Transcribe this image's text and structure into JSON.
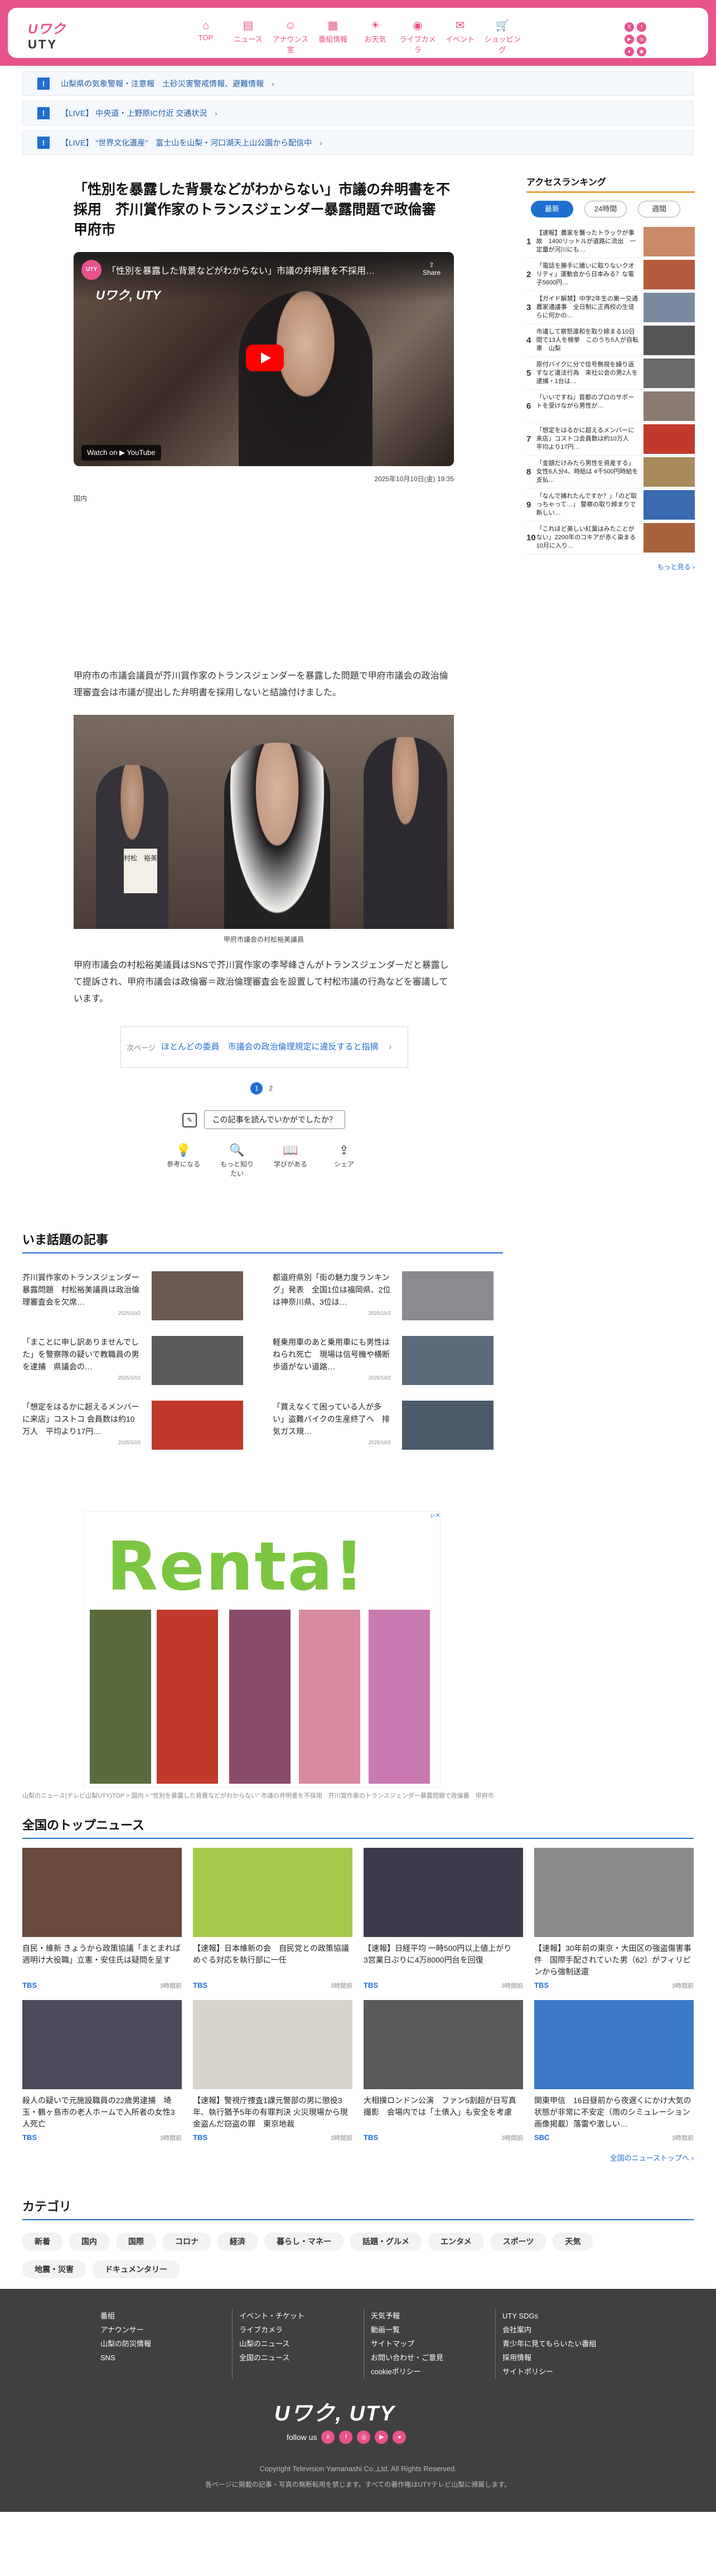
{
  "header": {
    "logo_top": "Uワク",
    "logo_bottom": "UTY",
    "nav": [
      {
        "label": "TOP",
        "icon": "⌂"
      },
      {
        "label": "ニュース",
        "icon": "▤"
      },
      {
        "label": "アナウンス室",
        "icon": "☺"
      },
      {
        "label": "番組情報",
        "icon": "▦"
      },
      {
        "label": "お天気",
        "icon": "☀"
      },
      {
        "label": "ライブカメラ",
        "icon": "◉"
      },
      {
        "label": "イベント",
        "icon": "✉"
      },
      {
        "label": "ショッピング",
        "icon": "🛒"
      }
    ],
    "social": [
      "X",
      "f",
      "▶",
      "◎",
      "●",
      "◉"
    ]
  },
  "alerts": [
    {
      "text": "山梨県の気象警報・注意報　土砂災害警戒情報、避難情報"
    },
    {
      "text": "【LIVE】 中央道・上野原IC付近 交通状況"
    },
    {
      "text": "【LIVE】 \"世界文化遺産\"　富士山を山梨・河口湖天上山公園から配信中"
    }
  ],
  "article": {
    "title": "「性別を暴露した背景などがわからない」市議の弁明書を不採用　芥川賞作家のトランスジェンダー暴露問題で政倫審　甲府市",
    "video_title": "「性別を暴露した背景などがわからない」市議の弁明書を不採用…",
    "video_logo": "Uワク, UTY",
    "share": "Share",
    "watch_on": "Watch on ▶ YouTube",
    "date": "2025年10月10日(金) 19:35",
    "category": "国内",
    "body1": "甲府市の市議会議員が芥川賞作家のトランスジェンダーを暴露した問題で甲府市議会の政治倫理審査会は市議が提出した弁明書を採用しないと結論付けました。",
    "photo_caption": "甲府市議会の村松裕美議員",
    "photo_nameplate": "村松　裕美",
    "body2": "甲府市議会の村松裕美議員はSNSで芥川賞作家の李琴峰さんがトランスジェンダーだと暴露して提訴され、甲府市議会は政倫審＝政治倫理審査会を設置して村松市議の行為などを審議しています。",
    "next_label": "次ページ",
    "next_title": "ほとんどの委員　市議会の政治倫理規定に違反すると指摘",
    "pages": [
      "1",
      "2"
    ],
    "feedback": "この記事を読んでいかがでしたか？",
    "reactions": [
      {
        "label": "参考になる",
        "icon": "💡"
      },
      {
        "label": "もっと知りたい",
        "icon": "🔍"
      },
      {
        "label": "学びがある",
        "icon": "📖"
      },
      {
        "label": "シェア",
        "icon": "⇪"
      }
    ]
  },
  "ranking": {
    "title": "アクセスランキング",
    "tabs": [
      "最新",
      "24時間",
      "週間"
    ],
    "items": [
      {
        "n": "1",
        "text": "【速報】農家を襲ったトラックが事故　1400リットルが道路に流出　一定量が河川にも…",
        "color": "#c98a6a"
      },
      {
        "n": "2",
        "text": "「電話を勝手に嬉いに取りないクオリティ」運動会から日本みる？な電子5600円…",
        "color": "#b55a3a"
      },
      {
        "n": "3",
        "text": "【ガイド解禁】中学2年生の第一交通農家通議事　全日制に正再校の生徒らに何かの…",
        "color": "#7a8aa0"
      },
      {
        "n": "4",
        "text": "市議して察怒違和を取り締まる10日間で13人を検挙　このうち5人が自転車　山梨",
        "color": "#555"
      },
      {
        "n": "5",
        "text": "原付バイクに分で信号無視を繰り返すなど違法行為　来社公会の男2人を逮捕・1台は…",
        "color": "#6a6a6a"
      },
      {
        "n": "6",
        "text": "「いいですね」首都のプロのサポートを受けながら男性が…",
        "color": "#8a7a70"
      },
      {
        "n": "7",
        "text": "「想定をはるかに超えるメンバーに来店」コストコ会員数は約10万人　平均より17円…",
        "color": "#c0392b"
      },
      {
        "n": "8",
        "text": "「金額だけみたら男性を資産する」女性6人分4、時給は 4千500円時給を支払…",
        "color": "#a88a5a"
      },
      {
        "n": "9",
        "text": "「なんで捕れたんですか？」「のど取っちゃって…」 警察の取り締まりで新しい…",
        "color": "#3a6ab0"
      },
      {
        "n": "10",
        "text": "「これほど美しい紅葉はみたことがない」2200年のコキアが赤く染まる　10月に入り…",
        "color": "#a8623a"
      }
    ],
    "more": "もっと見る ›"
  },
  "wadai": {
    "title": "いま話題の記事",
    "items": [
      {
        "text": "芥川賞作家のトランスジェンダー暴露問題　村松裕美議員は政治倫理審査会を欠席…",
        "date": "2025/10/2",
        "color": "#6a5a50"
      },
      {
        "text": "都道府県別「街の魅力度ランキング」発表　全国1位は福岡県、2位は神奈川県、3位は…",
        "date": "2025/10/2",
        "color": "#8a8a90"
      },
      {
        "text": "「まことに申し訳ありませんでした」を警察隊の疑いで教職員の男を逮捕　県議会の…",
        "date": "2025/10/2",
        "color": "#5a5a5a"
      },
      {
        "text": "軽乗用車のあと乗用車にも男性はねられ死亡　現場は信号機や横断歩道がない道路…",
        "date": "2025/10/2",
        "color": "#5a6a7a"
      },
      {
        "text": "「想定をはるかに超えるメンバーに来店」コストコ 会員数は約10万人　平均より17円…",
        "date": "2025/10/2",
        "color": "#c0392b"
      },
      {
        "text": "「買えなくて困っている人が多い」盗難バイクの生産終了へ　排気ガス規…",
        "date": "2025/10/2",
        "color": "#4a5a6a"
      }
    ]
  },
  "ad": {
    "brand": "Renta!",
    "marker": "▷✕"
  },
  "breadcrumb": "山梨のニュース(テレビ山梨UTY)TOP > 国内 > \"性別を暴露した背景などがわからない\" 市議の弁明書を不採用　芥川賞作家のトランスジェンダー暴露問題で政倫審　甲府市",
  "topnews": {
    "title": "全国のトップニュース",
    "items": [
      {
        "text": "自民・維新 きょうから政策協議「まとまれば週明け大役職」立憲・安住氏は疑問を呈す",
        "src": "TBS",
        "time": "3時間前",
        "color": "#6a4a3a"
      },
      {
        "text": "【速報】日本維新の会　自民党との政策協議めぐる対応を執行部に一任",
        "src": "TBS",
        "time": "3時間前",
        "color": "#a7c94a"
      },
      {
        "text": "【速報】日経平均 一時500円以上値上がり　3営業日ぶりに4万8000円台を回復",
        "src": "TBS",
        "time": "3時間前",
        "color": "#3a3a4a"
      },
      {
        "text": "【速報】30年前の東京・大田区の強盗傷害事件　国際手配されていた男（62）がフィリピンから強制送還",
        "src": "TBS",
        "time": "3時間前",
        "color": "#8a8a8a"
      },
      {
        "text": "殺人の疑いで元施設職員の22歳男逮捕　埼玉・鶴ヶ島市の老人ホームで入所者の女性3人死亡",
        "src": "TBS",
        "time": "3時間前",
        "color": "#4a4a5a"
      },
      {
        "text": "【速報】警視庁捜査1課元警部の男に懲役3年、執行猶予5年の有罪判決 火災現場から現金盗んだ窃盗の罪　東京地裁",
        "src": "TBS",
        "time": "3時間前",
        "color": "#d8d4cc"
      },
      {
        "text": "大相撲ロンドン公演　ファン5割超が日写真撮影　会場内では「土俵入」も安全を考慮",
        "src": "TBS",
        "time": "3時間前",
        "color": "#5a5a5a"
      },
      {
        "text": "関東甲信　16日昼前から夜遅くにかけ大気の状態が非常に不安定（雨のシミュレーション画像掲載）落雷や激しい…",
        "src": "SBC",
        "time": "3時間前",
        "color": "#3a7ac8"
      }
    ],
    "more": "全国のニューストップへ ›"
  },
  "categories": {
    "title": "カテゴリ",
    "items": [
      "新着",
      "国内",
      "国際",
      "コロナ",
      "経済",
      "暮らし・マネー",
      "話題・グルメ",
      "エンタメ",
      "スポーツ",
      "天気",
      "地震・災害",
      "ドキュメンタリー"
    ]
  },
  "footer": {
    "cols": [
      [
        "番組",
        "アナウンサー",
        "山梨の防災情報",
        "SNS"
      ],
      [
        "イベント・チケット",
        "ライブカメラ",
        "山梨のニュース",
        "全国のニュース"
      ],
      [
        "天気予報",
        "動画一覧",
        "サイトマップ",
        "お問い合わせ・ご意見",
        "cookieポリシー"
      ],
      [
        "UTY SDGs",
        "会社案内",
        "青少年に見てもらいたい番組",
        "採用情報",
        "サイトポリシー"
      ]
    ],
    "logo": "Uワク, UTY",
    "follow": "follow us",
    "social": [
      "X",
      "f",
      "◎",
      "▶",
      "●"
    ],
    "copyright": "Copyright Television Yamanashi Co.,Ltd. All Rights Reserved.",
    "notice": "各ページに掲載の記事・写真の無断転用を禁じます。すべての著作権はUTYテレビ山梨に帰属します。"
  }
}
